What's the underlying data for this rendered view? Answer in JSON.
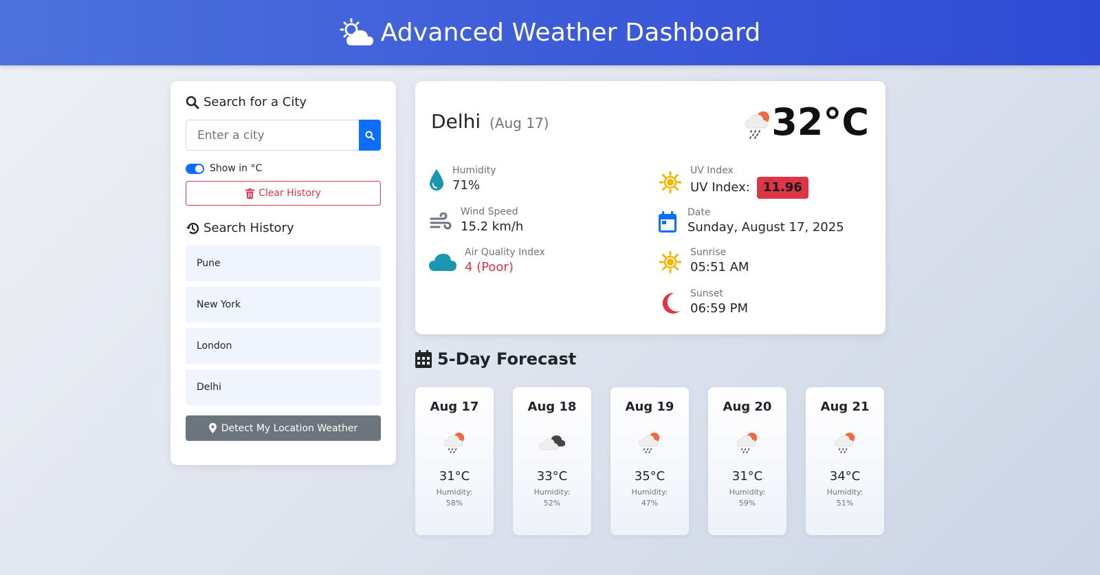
{
  "header": {
    "title": "Advanced Weather Dashboard",
    "icon": "sun-cloud-icon"
  },
  "sidebar": {
    "search_heading": "Search for a City",
    "search_placeholder": "Enter a city",
    "search_value": "",
    "unit_toggle_label": "Show in °C",
    "unit_toggle_on": true,
    "clear_history_label": "Clear History",
    "history_heading": "Search History",
    "history": [
      "Pune",
      "New York",
      "London",
      "Delhi"
    ],
    "detect_location_label": "Detect My Location Weather"
  },
  "current": {
    "city": "Delhi",
    "date": "(Aug 17)",
    "temperature": "32°C",
    "icon": "rain-sun-cloud-icon",
    "humidity": {
      "label": "Humidity",
      "value": "71%"
    },
    "wind": {
      "label": "Wind Speed",
      "value": "15.2 km/h"
    },
    "aqi": {
      "label": "Air Quality Index",
      "value": "4 (Poor)"
    },
    "uv": {
      "label": "UV Index",
      "prefix": "UV Index:",
      "value": "11.96"
    },
    "full_date": {
      "label": "Date",
      "value": "Sunday, August 17, 2025"
    },
    "sunrise": {
      "label": "Sunrise",
      "value": "05:51 AM"
    },
    "sunset": {
      "label": "Sunset",
      "value": "06:59 PM"
    }
  },
  "forecast": {
    "title": "5-Day Forecast",
    "days": [
      {
        "date": "Aug 17",
        "temp": "31°C",
        "humidity_label": "Humidity:",
        "humidity": "58%",
        "icon": "rain-sun-cloud-icon"
      },
      {
        "date": "Aug 18",
        "temp": "33°C",
        "humidity_label": "Humidity:",
        "humidity": "52%",
        "icon": "broken-clouds-icon"
      },
      {
        "date": "Aug 19",
        "temp": "35°C",
        "humidity_label": "Humidity:",
        "humidity": "47%",
        "icon": "rain-sun-cloud-icon"
      },
      {
        "date": "Aug 20",
        "temp": "31°C",
        "humidity_label": "Humidity:",
        "humidity": "59%",
        "icon": "rain-sun-cloud-icon"
      },
      {
        "date": "Aug 21",
        "temp": "34°C",
        "humidity_label": "Humidity:",
        "humidity": "51%",
        "icon": "rain-sun-cloud-icon"
      }
    ]
  },
  "colors": {
    "header_start": "#4d72dd",
    "header_end": "#2f4ad4",
    "primary": "#0d6efd",
    "danger": "#dc3545",
    "secondary": "#6c757d"
  }
}
